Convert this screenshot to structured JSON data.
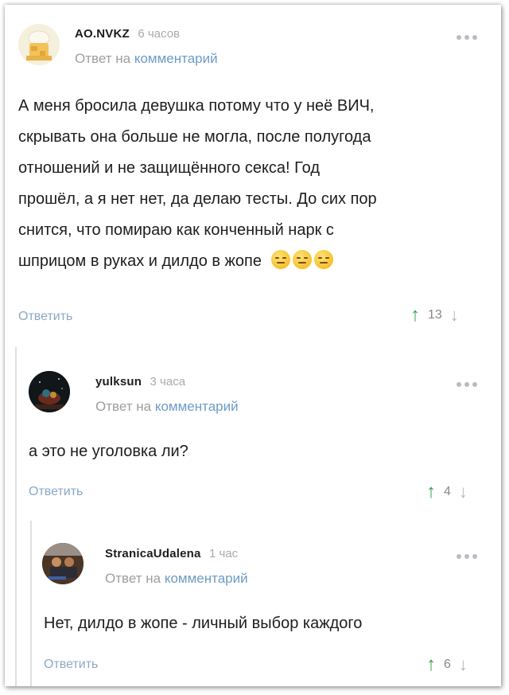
{
  "comments": [
    {
      "author": "AO.NVKZ",
      "time": "6 часов",
      "reply_prefix": "Ответ на",
      "reply_link": "комментарий",
      "lines": [
        "А меня бросила девушка потому что у неё ВИЧ,",
        "скрывать она больше не могла, после полугода",
        "отношений и не защищённого секса! Год",
        "прошёл, а я нет нет, да делаю тесты. До сих пор",
        "снится, что помираю как конченный нарк с",
        "шприцом в руках и дилдо в жопе"
      ],
      "emojis": [
        "expressionless-face-emoji",
        "expressionless-face-emoji",
        "expressionless-face-emoji"
      ],
      "answer_label": "Ответить",
      "score": "13"
    },
    {
      "author": "yulksun",
      "time": "3 часа",
      "reply_prefix": "Ответ на",
      "reply_link": "комментарий",
      "lines": [
        "а это не уголовка ли?"
      ],
      "answer_label": "Ответить",
      "score": "4"
    },
    {
      "author": "StranicaUdalena",
      "time": "1 час",
      "reply_prefix": "Ответ на",
      "reply_link": "комментарий",
      "lines": [
        "Нет, дилдо в жопе - личный выбор каждого"
      ],
      "answer_label": "Ответить",
      "score": "6"
    }
  ],
  "colors": {
    "upvote": "#2fa64a",
    "link": "#6e9bc6",
    "muted": "#a9a9a9"
  },
  "icons": {
    "more": "more-dots-icon",
    "upvote": "arrow-up-icon",
    "downvote": "arrow-down-icon"
  }
}
